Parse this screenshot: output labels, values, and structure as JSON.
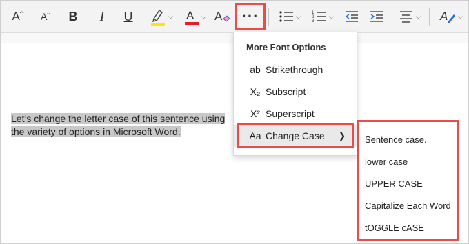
{
  "toolbar": {
    "items": [
      {
        "name": "grow-font-icon",
        "glyph": "Aˆ"
      },
      {
        "name": "shrink-font-icon",
        "glyph": "Aˇ"
      },
      {
        "name": "bold-icon",
        "glyph": "B"
      },
      {
        "name": "italic-icon",
        "glyph": "I"
      },
      {
        "name": "underline-icon",
        "glyph": "U"
      }
    ],
    "more_options_glyph": "···",
    "highlight_color": "#ffe500",
    "font_color": "#e3202a",
    "accent_red": "#ea4b4b"
  },
  "document": {
    "line1": "Let’s change the letter case of this sentence using",
    "line2": "the variety of options in Microsoft Word."
  },
  "menu": {
    "title": "More Font Options",
    "items": [
      {
        "icon": "ab",
        "label": "Strikethrough"
      },
      {
        "icon": "X₂",
        "label": "Subscript"
      },
      {
        "icon": "X²",
        "label": "Superscript"
      },
      {
        "icon": "Aa",
        "label": "Change Case",
        "arrow": "❯"
      }
    ]
  },
  "submenu": {
    "items": [
      "Sentence case.",
      "lower case",
      "UPPER CASE",
      "Capitalize Each Word",
      "tOGGLE cASE"
    ]
  }
}
